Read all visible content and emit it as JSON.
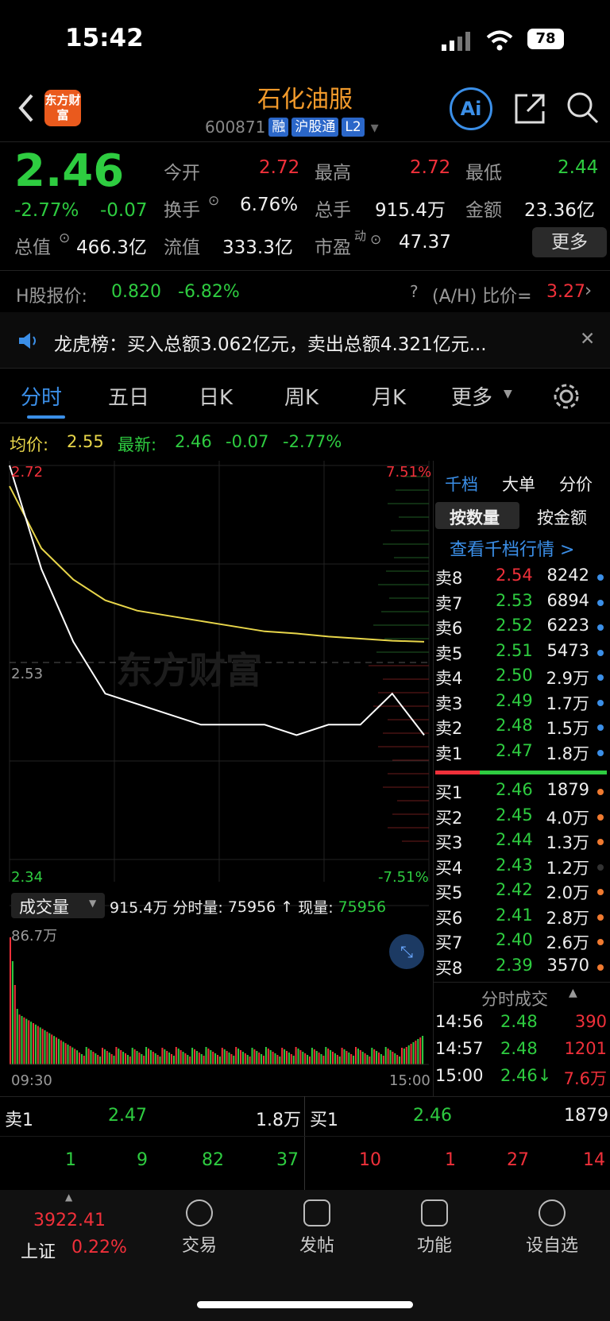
{
  "status": {
    "time": "15:42",
    "battery": "78"
  },
  "header": {
    "logo": "东方财富",
    "title": "石化油服",
    "code": "600871",
    "tags": [
      "融",
      "沪股通",
      "L2"
    ],
    "ai_label": "Ai"
  },
  "quote": {
    "price": "2.46",
    "change_pct": "-2.77%",
    "change": "-0.07",
    "open_label": "今开",
    "open": "2.72",
    "high_label": "最高",
    "high": "2.72",
    "low_label": "最低",
    "low": "2.44",
    "turnover_label": "换手",
    "turnover": "6.76%",
    "volume_label": "总手",
    "volume": "915.4万",
    "amount_label": "金额",
    "amount": "23.36亿",
    "mktcap_label": "总值",
    "mktcap": "466.3亿",
    "float_label": "流值",
    "float": "333.3亿",
    "pe_label": "市盈",
    "pe_sup": "动",
    "pe": "47.37",
    "more": "更多"
  },
  "hshare": {
    "label": "H股报价:",
    "price": "0.820",
    "pct": "-6.82%",
    "ratio_label": "(A/H) 比价=",
    "ratio": "3.27"
  },
  "notice": {
    "text": "龙虎榜：买入总额3.062亿元，卖出总额4.321亿元..."
  },
  "tabs": [
    "分时",
    "五日",
    "日K",
    "周K",
    "月K",
    "更多"
  ],
  "chart_info": {
    "avg_label": "均价:",
    "avg": "2.55",
    "latest_label": "最新:",
    "latest": "2.46",
    "chg": "-0.07",
    "pct": "-2.77%"
  },
  "chart": {
    "y_high": "2.72",
    "y_mid": "2.53",
    "y_low": "2.34",
    "pct_high": "7.51%",
    "pct_low": "-7.51%",
    "watermark": "东方财富",
    "vol_label": "成交量",
    "vol_total": "915.4万",
    "vol_min_label": "分时量:",
    "vol_min": "75956",
    "vol_now_label": "现量:",
    "vol_now": "75956",
    "vol_max": "86.7万",
    "time_start": "09:30",
    "time_end": "15:00"
  },
  "chart_data": {
    "type": "line",
    "series": [
      {
        "name": "均价",
        "values": [
          2.7,
          2.64,
          2.61,
          2.59,
          2.58,
          2.575,
          2.57,
          2.565,
          2.56,
          2.558,
          2.555,
          2.553,
          2.551,
          2.55
        ]
      },
      {
        "name": "最新",
        "values": [
          2.72,
          2.62,
          2.55,
          2.5,
          2.49,
          2.48,
          2.47,
          2.47,
          2.47,
          2.46,
          2.47,
          2.47,
          2.5,
          2.46
        ]
      }
    ],
    "ylim": [
      2.34,
      2.72
    ],
    "reference": 2.53
  },
  "orderbook": {
    "tabs": [
      "千档",
      "大单",
      "分价"
    ],
    "subtabs": [
      "按数量",
      "按金额"
    ],
    "link": "查看千档行情 >",
    "sell": [
      {
        "label": "卖8",
        "price": "2.54",
        "vol": "8242",
        "up": true
      },
      {
        "label": "卖7",
        "price": "2.53",
        "vol": "6894",
        "up": false
      },
      {
        "label": "卖6",
        "price": "2.52",
        "vol": "6223",
        "up": false
      },
      {
        "label": "卖5",
        "price": "2.51",
        "vol": "5473",
        "up": false
      },
      {
        "label": "卖4",
        "price": "2.50",
        "vol": "2.9万",
        "up": false
      },
      {
        "label": "卖3",
        "price": "2.49",
        "vol": "1.7万",
        "up": false
      },
      {
        "label": "卖2",
        "price": "2.48",
        "vol": "1.5万",
        "up": false
      },
      {
        "label": "卖1",
        "price": "2.47",
        "vol": "1.8万",
        "up": false
      }
    ],
    "buy": [
      {
        "label": "买1",
        "price": "2.46",
        "vol": "1879"
      },
      {
        "label": "买2",
        "price": "2.45",
        "vol": "4.0万"
      },
      {
        "label": "买3",
        "price": "2.44",
        "vol": "1.3万"
      },
      {
        "label": "买4",
        "price": "2.43",
        "vol": "1.2万"
      },
      {
        "label": "买5",
        "price": "2.42",
        "vol": "2.0万"
      },
      {
        "label": "买6",
        "price": "2.41",
        "vol": "2.8万"
      },
      {
        "label": "买7",
        "price": "2.40",
        "vol": "2.6万"
      },
      {
        "label": "买8",
        "price": "2.39",
        "vol": "3570"
      }
    ],
    "ticks_label": "分时成交",
    "ticks": [
      {
        "time": "14:56",
        "price": "2.48",
        "vol": "390"
      },
      {
        "time": "14:57",
        "price": "2.48",
        "vol": "1201"
      },
      {
        "time": "15:00",
        "price": "2.46↓",
        "vol": "7.6万"
      }
    ]
  },
  "level2": {
    "sell_label": "卖1",
    "sell_price": "2.47",
    "sell_vol": "1.8万",
    "buy_label": "买1",
    "buy_price": "2.46",
    "buy_vol": "1879",
    "sell_queue": [
      "1",
      "9",
      "82",
      "37"
    ],
    "buy_queue": [
      "10",
      "1",
      "27",
      "14"
    ]
  },
  "bottom": {
    "index_value": "3922.41",
    "index_name": "上证",
    "index_pct": "0.22%",
    "nav": [
      "交易",
      "发帖",
      "功能",
      "设自选"
    ]
  }
}
